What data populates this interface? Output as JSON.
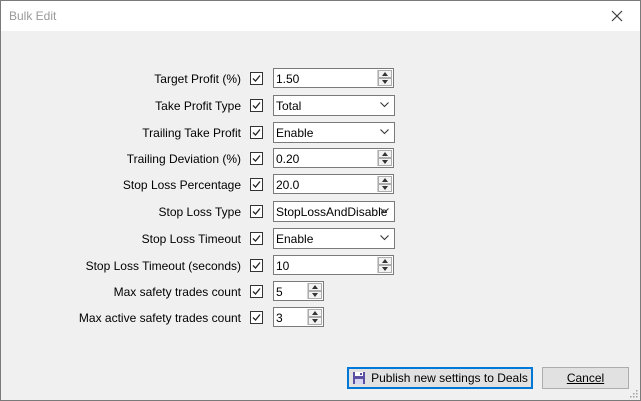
{
  "window": {
    "title": "Bulk Edit"
  },
  "fields": [
    {
      "label": "Target Profit (%)",
      "checked": true,
      "type": "spin",
      "value": "1.50"
    },
    {
      "label": "Take Profit Type",
      "checked": true,
      "type": "combo",
      "value": "Total"
    },
    {
      "label": "Trailing Take Profit",
      "checked": true,
      "type": "combo",
      "value": "Enable"
    },
    {
      "label": "Trailing Deviation (%)",
      "checked": true,
      "type": "spin",
      "value": "0.20"
    },
    {
      "label": "Stop Loss Percentage",
      "checked": true,
      "type": "spin",
      "value": "20.0"
    },
    {
      "label": "Stop Loss Type",
      "checked": true,
      "type": "combo",
      "value": "StopLossAndDisable"
    },
    {
      "label": "Stop Loss Timeout",
      "checked": true,
      "type": "combo",
      "value": "Enable"
    },
    {
      "label": "Stop Loss Timeout (seconds)",
      "checked": true,
      "type": "spin",
      "value": "10"
    },
    {
      "label": "Max safety trades count",
      "checked": true,
      "type": "spin",
      "value": "5"
    },
    {
      "label": "Max active safety trades count",
      "checked": true,
      "type": "spin",
      "value": "3"
    }
  ],
  "buttons": {
    "publish": {
      "label": "Publish new settings to Deals",
      "icon": "save-icon"
    },
    "cancel": {
      "label": "Cancel"
    }
  }
}
